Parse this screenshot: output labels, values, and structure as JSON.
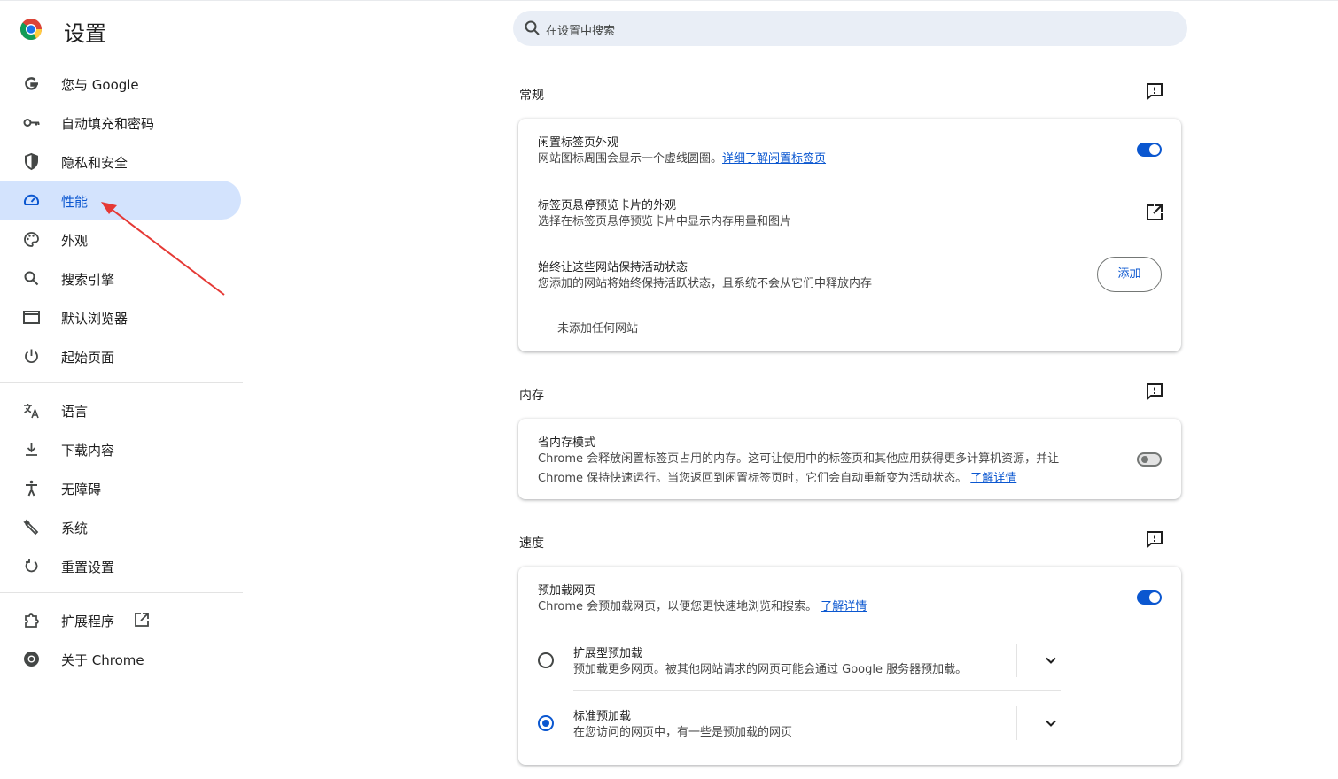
{
  "app": {
    "title": "设置"
  },
  "search": {
    "placeholder": "在设置中搜索"
  },
  "sidebar": {
    "items": [
      {
        "label": "您与 Google",
        "icon": "google-g-icon"
      },
      {
        "label": "自动填充和密码",
        "icon": "key-icon"
      },
      {
        "label": "隐私和安全",
        "icon": "shield-icon"
      },
      {
        "label": "性能",
        "icon": "speedometer-icon",
        "active": true
      },
      {
        "label": "外观",
        "icon": "palette-icon"
      },
      {
        "label": "搜索引擎",
        "icon": "search-icon"
      },
      {
        "label": "默认浏览器",
        "icon": "browser-window-icon"
      },
      {
        "label": "起始页面",
        "icon": "power-icon"
      }
    ],
    "items2": [
      {
        "label": "语言",
        "icon": "translate-icon"
      },
      {
        "label": "下载内容",
        "icon": "download-icon"
      },
      {
        "label": "无障碍",
        "icon": "accessibility-icon"
      },
      {
        "label": "系统",
        "icon": "wrench-icon"
      },
      {
        "label": "重置设置",
        "icon": "reset-icon"
      }
    ],
    "items3": [
      {
        "label": "扩展程序",
        "icon": "puzzle-icon"
      },
      {
        "label": "关于 Chrome",
        "icon": "chrome-icon"
      }
    ]
  },
  "sections": {
    "general": {
      "title": "常规",
      "inactive_tabs": {
        "title": "闲置标签页外观",
        "sub": "网站图标周围会显示一个虚线圆圈。",
        "link": "详细了解闲置标签页",
        "enabled": true
      },
      "hover_card": {
        "title": "标签页悬停预览卡片的外观",
        "sub": "选择在标签页悬停预览卡片中显示内存用量和图片"
      },
      "keep_active": {
        "title": "始终让这些网站保持活动状态",
        "sub": "您添加的网站将始终保持活跃状态，且系统不会从它们中释放内存",
        "button": "添加",
        "empty": "未添加任何网站"
      }
    },
    "memory": {
      "title": "内存",
      "saver": {
        "title": "省内存模式",
        "sub1": "Chrome 会释放闲置标签页占用的内存。这可让使用中的标签页和其他应用获得更多计算机资源，并让",
        "sub2": "Chrome 保持快速运行。当您返回到闲置标签页时，它们会自动重新变为活动状态。",
        "link": "了解详情",
        "enabled": false
      }
    },
    "speed": {
      "title": "速度",
      "preload": {
        "title": "预加载网页",
        "sub": "Chrome 会预加载网页，以便您更快速地浏览和搜索。",
        "link": "了解详情",
        "enabled": true
      },
      "extended": {
        "title": "扩展型预加载",
        "sub": "预加载更多网页。被其他网站请求的网页可能会通过 Google 服务器预加载。",
        "selected": false
      },
      "standard": {
        "title": "标准预加载",
        "sub": "在您访问的网页中，有一些是预加载的网页",
        "selected": true
      }
    }
  },
  "colors": {
    "accent": "#0b57d0",
    "active_nav_bg": "#d3e3fd",
    "search_bg": "#e9eef6",
    "arrow": "#e53935"
  }
}
